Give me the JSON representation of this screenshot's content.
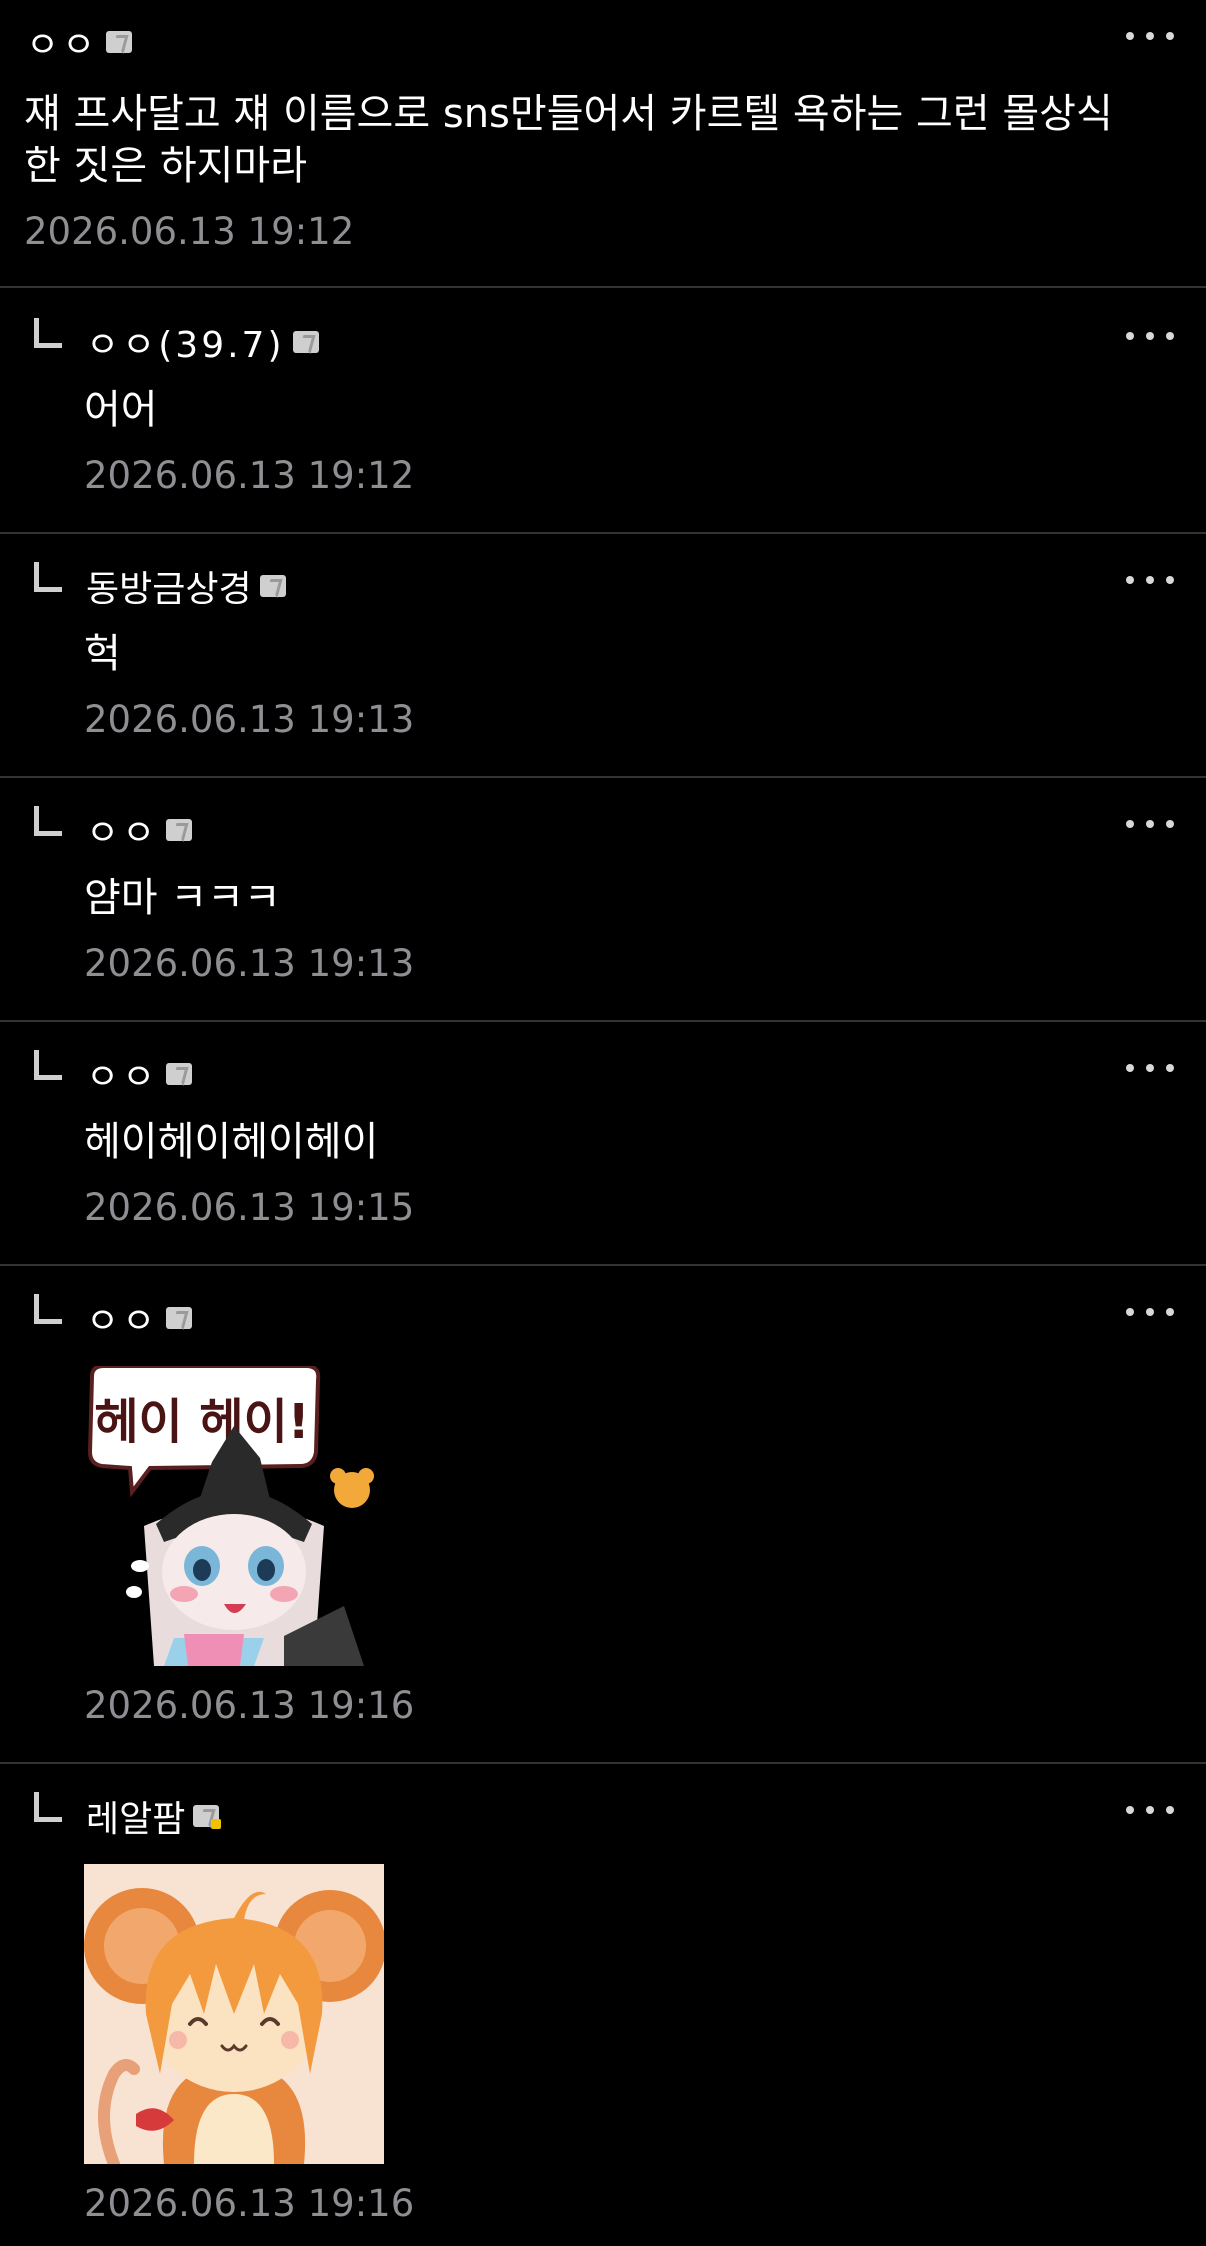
{
  "post": {
    "nickname": "ㅇㅇ",
    "text_line1": "쟤 프사달고 쟤 이름으로 sns만들어서 카르텔 욕하는 그런 몰상식",
    "text_line2": "한 짓은 하지마라",
    "date": "2026.06.13 19:12"
  },
  "replies": [
    {
      "nickname": "ㅇㅇ(39.7)",
      "text": "어어",
      "date": "2026.06.13 19:12"
    },
    {
      "nickname": "동방금상경",
      "text": "헉",
      "date": "2026.06.13 19:13"
    },
    {
      "nickname": "ㅇㅇ",
      "text": "얌마 ㅋㅋㅋ",
      "date": "2026.06.13 19:13"
    },
    {
      "nickname": "ㅇㅇ",
      "text": "헤이헤이헤이헤이",
      "date": "2026.06.13 19:15"
    },
    {
      "nickname": "ㅇㅇ",
      "sticker": "sticker-hey-hey",
      "sticker_text": "헤이 헤이!",
      "date": "2026.06.13 19:16"
    },
    {
      "nickname": "레알팜",
      "sticker": "sticker-mouse-character",
      "date": "2026.06.13 19:16"
    }
  ],
  "icons": {
    "more": "more-dots-icon",
    "reply": "reply-arrow-icon",
    "badge": "fixed-nick-badge-icon"
  },
  "colors": {
    "background": "#000000",
    "text": "#ffffff",
    "date": "#8e8e93",
    "divider": "#333333"
  }
}
